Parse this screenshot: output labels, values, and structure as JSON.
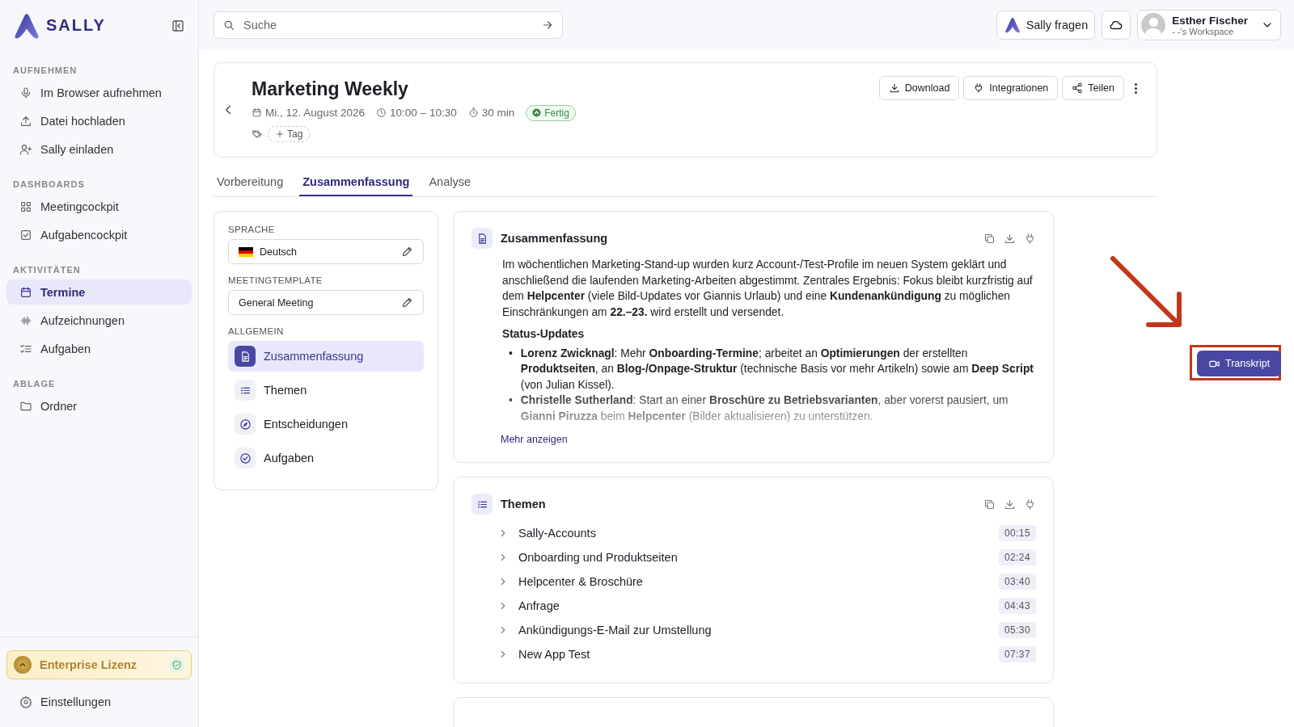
{
  "sidebar": {
    "logo": "SALLY",
    "sections": [
      {
        "heading": "AUFNEHMEN",
        "items": [
          {
            "label": "Im Browser aufnehmen",
            "selected": false
          },
          {
            "label": "Datei hochladen",
            "selected": false
          },
          {
            "label": "Sally einladen",
            "selected": false
          }
        ]
      },
      {
        "heading": "DASHBOARDS",
        "items": [
          {
            "label": "Meetingcockpit",
            "selected": false
          },
          {
            "label": "Aufgabencockpit",
            "selected": false
          }
        ]
      },
      {
        "heading": "AKTIVITÄTEN",
        "items": [
          {
            "label": "Termine",
            "selected": true
          },
          {
            "label": "Aufzeichnungen",
            "selected": false
          },
          {
            "label": "Aufgaben",
            "selected": false
          }
        ]
      },
      {
        "heading": "ABLAGE",
        "items": [
          {
            "label": "Ordner",
            "selected": false
          }
        ]
      }
    ],
    "license": "Enterprise Lizenz",
    "settings": "Einstellungen"
  },
  "topbar": {
    "search": {
      "placeholder": "Suche"
    },
    "ask_button": "Sally fragen",
    "user": {
      "name": "Esther Fischer",
      "workspace": "- -'s Workspace"
    }
  },
  "meeting": {
    "title": "Marketing Weekly",
    "date": "Mi., 12. August 2026",
    "time": "10:00 – 10:30",
    "duration": "30 min",
    "status": "Fertig",
    "tag_button": "Tag",
    "actions": [
      "Download",
      "Integrationen",
      "Teilen"
    ]
  },
  "tabs": [
    {
      "label": "Vorbereitung",
      "selected": false
    },
    {
      "label": "Zusammenfassung",
      "selected": true
    },
    {
      "label": "Analyse",
      "selected": false
    }
  ],
  "panel": {
    "language_label": "SPRACHE",
    "language": "Deutsch",
    "template_label": "MEETINGTEMPLATE",
    "template": "General Meeting",
    "general_heading": "ALLGEMEIN",
    "items": [
      {
        "label": "Zusammenfassung",
        "selected": true
      },
      {
        "label": "Themen",
        "selected": false
      },
      {
        "label": "Entscheidungen",
        "selected": false
      },
      {
        "label": "Aufgaben",
        "selected": false
      }
    ]
  },
  "summary": {
    "title": "Zusammenfassung",
    "paragraph": "Im wöchentlichen Marketing-Stand-up wurden kurz Account-/Test-Profile im neuen System geklärt und anschließend die laufenden Marketing-Arbeiten abgestimmt. Zentrales Ergebnis: Fokus bleibt kurzfristig auf dem **Helpcenter** (viele Bild-Updates vor Giannis Urlaub) und eine **Kundenankündigung** zu möglichen Einschränkungen am **22.–23.** wird erstellt und versendet.",
    "subheading": "Status-Updates",
    "bullets": [
      {
        "marker": "•",
        "text": "**Lorenz Zwicknagl**: Mehr **Onboarding-Termine**; arbeitet an **Optimierungen** der erstellten **Produktseiten**, an **Blog-/Onpage-Struktur** (technische Basis vor mehr Artikeln) sowie am **Deep Script** (von Julian Kissel)."
      },
      {
        "marker": "•",
        "text": "**Christelle Sutherland**: Start an einer **Broschüre zu Betriebsvarianten**, aber vorerst pausiert, um **Gianni Piruzza** beim **Helpcenter** (Bilder aktualisieren) zu unterstützen."
      }
    ],
    "more_link": "Mehr anzeigen"
  },
  "topics": {
    "title": "Themen",
    "items": [
      {
        "title": "Sally-Accounts",
        "time": "00:15"
      },
      {
        "title": "Onboarding und Produktseiten",
        "time": "02:24"
      },
      {
        "title": "Helpcenter & Broschüre",
        "time": "03:40"
      },
      {
        "title": "Anfrage",
        "time": "04:43"
      },
      {
        "title": "Ankündigungs-E-Mail zur Umstellung",
        "time": "05:30"
      },
      {
        "title": "New App Test",
        "time": "07:37"
      }
    ]
  },
  "transcript_button": "Transkript"
}
